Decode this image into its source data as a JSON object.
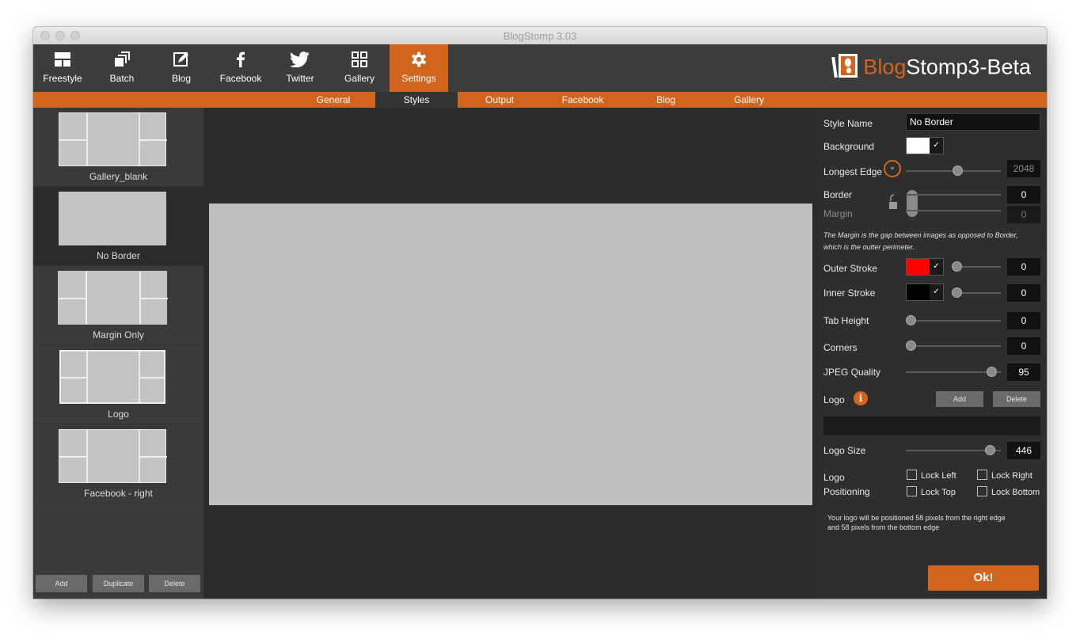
{
  "window": {
    "title": "BlogStomp 3.03"
  },
  "toolbar": {
    "items": [
      {
        "label": "Freestyle",
        "icon": "freestyle-icon"
      },
      {
        "label": "Batch",
        "icon": "batch-icon"
      },
      {
        "label": "Blog",
        "icon": "blog-icon"
      },
      {
        "label": "Facebook",
        "icon": "facebook-icon"
      },
      {
        "label": "Twitter",
        "icon": "twitter-icon"
      },
      {
        "label": "Gallery",
        "icon": "gallery-icon"
      },
      {
        "label": "Settings",
        "icon": "gear-icon",
        "active": true
      }
    ]
  },
  "brand": {
    "part1": "Blog",
    "part2": "Stomp3",
    "part3": "-Beta",
    "accent": "#d1651d"
  },
  "subnav": {
    "tabs": [
      {
        "label": "General"
      },
      {
        "label": "Styles",
        "active": true
      },
      {
        "label": "Output"
      },
      {
        "label": "Facebook"
      },
      {
        "label": "Blog"
      },
      {
        "label": "Gallery"
      }
    ]
  },
  "styles_list": {
    "items": [
      {
        "label": "Gallery_blank"
      },
      {
        "label": "No Border",
        "selected": true
      },
      {
        "label": "Margin Only"
      },
      {
        "label": "Logo"
      },
      {
        "label": "Facebook - right"
      }
    ],
    "buttons": {
      "add": "Add",
      "duplicate": "Duplicate",
      "delete": "Delete"
    }
  },
  "settings": {
    "style_name": {
      "label": "Style Name",
      "value": "No Border"
    },
    "background": {
      "label": "Background",
      "color": "#ffffff"
    },
    "longest_edge": {
      "label": "Longest Edge",
      "value": "2048",
      "level": 0.55
    },
    "border": {
      "label": "Border",
      "value": "0"
    },
    "margin": {
      "label": "Margin",
      "value": "0"
    },
    "margin_note": "The Margin is the gap between images as opposed to Border, which is the outter perimeter.",
    "outer_stroke": {
      "label": "Outer Stroke",
      "value": "0",
      "color": "#ff0000",
      "level": 0
    },
    "inner_stroke": {
      "label": "Inner Stroke",
      "value": "0",
      "color": "#000000",
      "level": 0
    },
    "tab_height": {
      "label": "Tab Height",
      "value": "0",
      "level": 0
    },
    "corners": {
      "label": "Corners",
      "value": "0",
      "level": 0
    },
    "jpeg_quality": {
      "label": "JPEG Quality",
      "value": "95",
      "level": 0.95
    },
    "logo": {
      "label": "Logo",
      "add": "Add",
      "delete": "Delete"
    },
    "logo_size": {
      "label": "Logo Size",
      "value": "446",
      "level": 0.93
    },
    "logo_positioning": {
      "label1": "Logo",
      "label2": "Positioning",
      "lock_left": "Lock Left",
      "lock_right": "Lock Right",
      "lock_top": "Lock Top",
      "lock_bottom": "Lock Bottom"
    },
    "position_note_1": "Your logo will be positioned 58 pixels from the right edge",
    "position_note_2": "and 58 pixels from the bottom edge",
    "ok": "Ok!"
  }
}
